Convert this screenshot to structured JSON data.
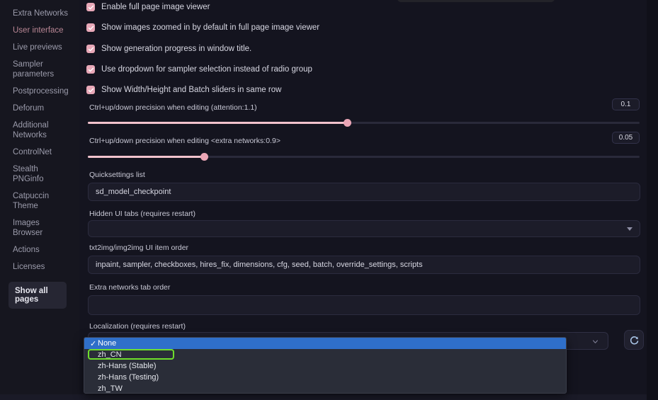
{
  "sidebar": {
    "items": [
      {
        "label": "",
        "state": "clipped"
      },
      {
        "label": "Extra Networks",
        "state": "normal"
      },
      {
        "label": "User interface",
        "state": "active"
      },
      {
        "label": "Live previews",
        "state": "normal"
      },
      {
        "label": "Sampler parameters",
        "state": "normal"
      },
      {
        "label": "Postprocessing",
        "state": "normal"
      },
      {
        "label": "Deforum",
        "state": "normal"
      },
      {
        "label": "Additional Networks",
        "state": "normal"
      },
      {
        "label": "ControlNet",
        "state": "normal"
      },
      {
        "label": "Stealth PNGinfo",
        "state": "normal"
      },
      {
        "label": "Catpuccin Theme",
        "state": "normal"
      },
      {
        "label": "Images Browser",
        "state": "normal"
      },
      {
        "label": "Actions",
        "state": "normal"
      },
      {
        "label": "Licenses",
        "state": "normal"
      }
    ],
    "show_all_pages_label": "Show all pages"
  },
  "checkboxes": [
    {
      "label": "Enable full page image viewer",
      "checked": true
    },
    {
      "label": "Show images zoomed in by default in full page image viewer",
      "checked": true
    },
    {
      "label": "Show generation progress in window title.",
      "checked": true
    },
    {
      "label": "Use dropdown for sampler selection instead of radio group",
      "checked": true
    },
    {
      "label": "Show Width/Height and Batch sliders in same row",
      "checked": true
    }
  ],
  "sliders": [
    {
      "label": "Ctrl+up/down precision when editing (attention:1.1)",
      "value": "0.1",
      "fill_percent": 47
    },
    {
      "label": "Ctrl+up/down precision when editing <extra networks:0.9>",
      "value": "0.05",
      "fill_percent": 21
    }
  ],
  "text_fields": [
    {
      "label": "Quicksettings list",
      "value": "sd_model_checkpoint",
      "placeholder": ""
    }
  ],
  "multiselect": {
    "label": "Hidden UI tabs (requires restart)",
    "value": "",
    "caret_icon": "caret-down-icon"
  },
  "order_fields": [
    {
      "label": "txt2img/img2img UI item order",
      "value": "inpaint, sampler, checkboxes, hires_fix, dimensions, cfg, seed, batch, override_settings, scripts"
    },
    {
      "label": "Extra networks tab order",
      "value": ""
    }
  ],
  "localization": {
    "label": "Localization (requires restart)",
    "selected_value": "",
    "chevron_icon": "chevron-down-icon",
    "refresh_icon": "refresh-icon",
    "options": [
      {
        "label": "None",
        "selected": true,
        "focused": false,
        "check": "✓"
      },
      {
        "label": "zh_CN",
        "selected": false,
        "focused": true,
        "check": ""
      },
      {
        "label": "zh-Hans (Stable)",
        "selected": false,
        "focused": false,
        "check": ""
      },
      {
        "label": "zh-Hans (Testing)",
        "selected": false,
        "focused": false,
        "check": ""
      },
      {
        "label": "zh_TW",
        "selected": false,
        "focused": false,
        "check": ""
      }
    ]
  },
  "colors": {
    "accent_pink": "#e8a8b8",
    "slider_fill": "#f2c3cd",
    "selected_blue": "#2f6fc9",
    "focus_green": "#6ede2c",
    "active_nav": "#b98795",
    "background": "#14141f"
  }
}
